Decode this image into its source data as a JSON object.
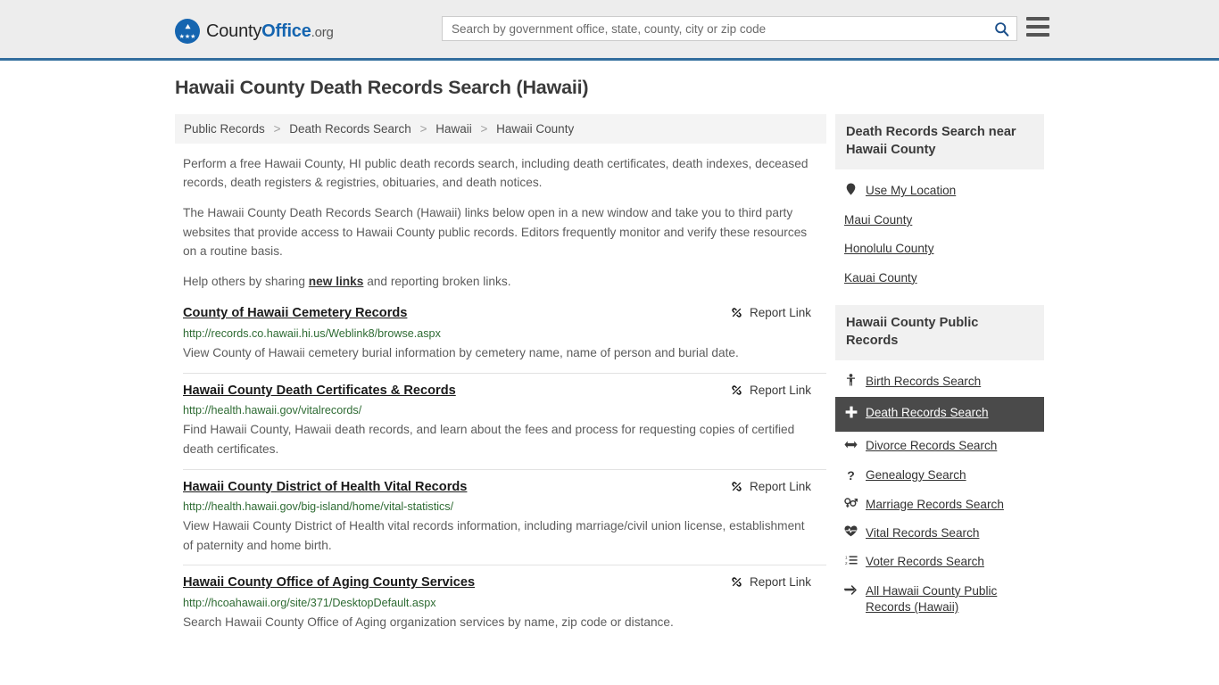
{
  "header": {
    "brand": {
      "part1": "County",
      "part2": "Office",
      "part3": ".org",
      "logo_icon": "eagle-stars-logo"
    },
    "search": {
      "placeholder": "Search by government office, state, county, city or zip code",
      "value": "",
      "icon": "search-icon"
    },
    "menu_icon": "hamburger-menu-icon"
  },
  "main": {
    "title": "Hawaii County Death Records Search (Hawaii)",
    "breadcrumb": [
      {
        "label": "Public Records"
      },
      {
        "label": "Death Records Search"
      },
      {
        "label": "Hawaii"
      },
      {
        "label": "Hawaii County"
      }
    ],
    "breadcrumb_separator": ">",
    "intro": [
      "Perform a free Hawaii County, HI public death records search, including death certificates, death indexes, deceased records, death registers & registries, obituaries, and death notices.",
      "The Hawaii County Death Records Search (Hawaii) links below open in a new window and take you to third party websites that provide access to Hawaii County public records. Editors frequently monitor and verify these resources on a routine basis."
    ],
    "help_prefix": "Help others by sharing ",
    "help_link": "new links",
    "help_suffix": " and reporting broken links.",
    "report_link_label": "Report Link",
    "report_link_icon": "broken-link-icon",
    "results": [
      {
        "title": "County of Hawaii Cemetery Records",
        "url": "http://records.co.hawaii.hi.us/Weblink8/browse.aspx",
        "description": "View County of Hawaii cemetery burial information by cemetery name, name of person and burial date."
      },
      {
        "title": "Hawaii County Death Certificates & Records",
        "url": "http://health.hawaii.gov/vitalrecords/",
        "description": "Find Hawaii County, Hawaii death records, and learn about the fees and process for requesting copies of certified death certificates."
      },
      {
        "title": "Hawaii County District of Health Vital Records",
        "url": "http://health.hawaii.gov/big-island/home/vital-statistics/",
        "description": "View Hawaii County District of Health vital records information, including marriage/civil union license, establishment of paternity and home birth."
      },
      {
        "title": "Hawaii County Office of Aging County Services",
        "url": "http://hcoahawaii.org/site/371/DesktopDefault.aspx",
        "description": "Search Hawaii County Office of Aging organization services by name, zip code or distance."
      }
    ]
  },
  "sidebar": {
    "nearby": {
      "heading": "Death Records Search near Hawaii County",
      "items": [
        {
          "label": "Use My Location",
          "icon": "map-pin-icon",
          "glyph": "•",
          "active": false
        },
        {
          "label": "Maui County",
          "icon": "none",
          "glyph": "",
          "active": false
        },
        {
          "label": "Honolulu County",
          "icon": "none",
          "glyph": "",
          "active": false
        },
        {
          "label": "Kauai County",
          "icon": "none",
          "glyph": "",
          "active": false
        }
      ]
    },
    "public_records": {
      "heading": "Hawaii County Public Records",
      "items": [
        {
          "label": "Birth Records Search",
          "icon": "baby-icon",
          "glyph": "♀",
          "active": false
        },
        {
          "label": "Death Records Search",
          "icon": "cross-icon",
          "glyph": "✚",
          "active": true
        },
        {
          "label": "Divorce Records Search",
          "icon": "left-right-arrow-icon",
          "glyph": "↔",
          "active": false
        },
        {
          "label": "Genealogy Search",
          "icon": "question-mark-icon",
          "glyph": "?",
          "active": false
        },
        {
          "label": "Marriage Records Search",
          "icon": "venus-mars-icon",
          "glyph": "⚥",
          "active": false
        },
        {
          "label": "Vital Records Search",
          "icon": "heartbeat-icon",
          "glyph": "♥",
          "active": false
        },
        {
          "label": "Voter Records Search",
          "icon": "ordered-list-icon",
          "glyph": "≣",
          "active": false
        },
        {
          "label": "All Hawaii County Public Records (Hawaii)",
          "icon": "arrow-right-icon",
          "glyph": "→",
          "active": false
        }
      ]
    }
  },
  "colors": {
    "header_bg": "#ededed",
    "header_border": "#336e9e",
    "brand_blue": "#1565b0",
    "url_green": "#2e6b33",
    "active_bg": "#4a4a4a",
    "panel_bg": "#f1f1f1"
  }
}
